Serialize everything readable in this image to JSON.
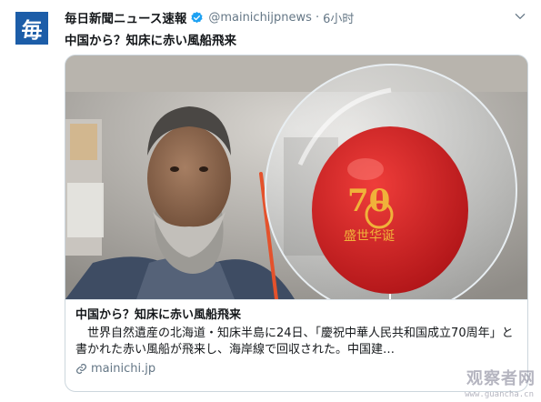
{
  "account": {
    "avatar_glyph": "毎",
    "display_name": "毎日新聞ニュース速報",
    "handle": "@mainichijpnews",
    "separator": "·",
    "time": "6小时",
    "verified": true
  },
  "tweet": {
    "text": "中国から？知床に赤い風船飛来"
  },
  "card": {
    "title": "中国から？知床に赤い風船飛来",
    "description": "　世界自然遺産の北海道・知床半島に24日、「慶祝中華人民共和国成立70周年」と書かれた赤い風船が飛来し、海岸線で回収された。中国建…",
    "link": "mainichi.jp",
    "image_icon": "photo-man-holding-red-balloon",
    "balloon_mark": "70",
    "balloon_script": "盛世华诞"
  },
  "watermark": {
    "text": "观察者网",
    "sub": "www.guancha.cn"
  },
  "colors": {
    "avatar_bg": "#1c5da8",
    "balloon_red": "#d9262a",
    "emblem_gold": "#f0b23a",
    "verified_blue": "#1da1f2",
    "secondary_text": "#657786"
  }
}
